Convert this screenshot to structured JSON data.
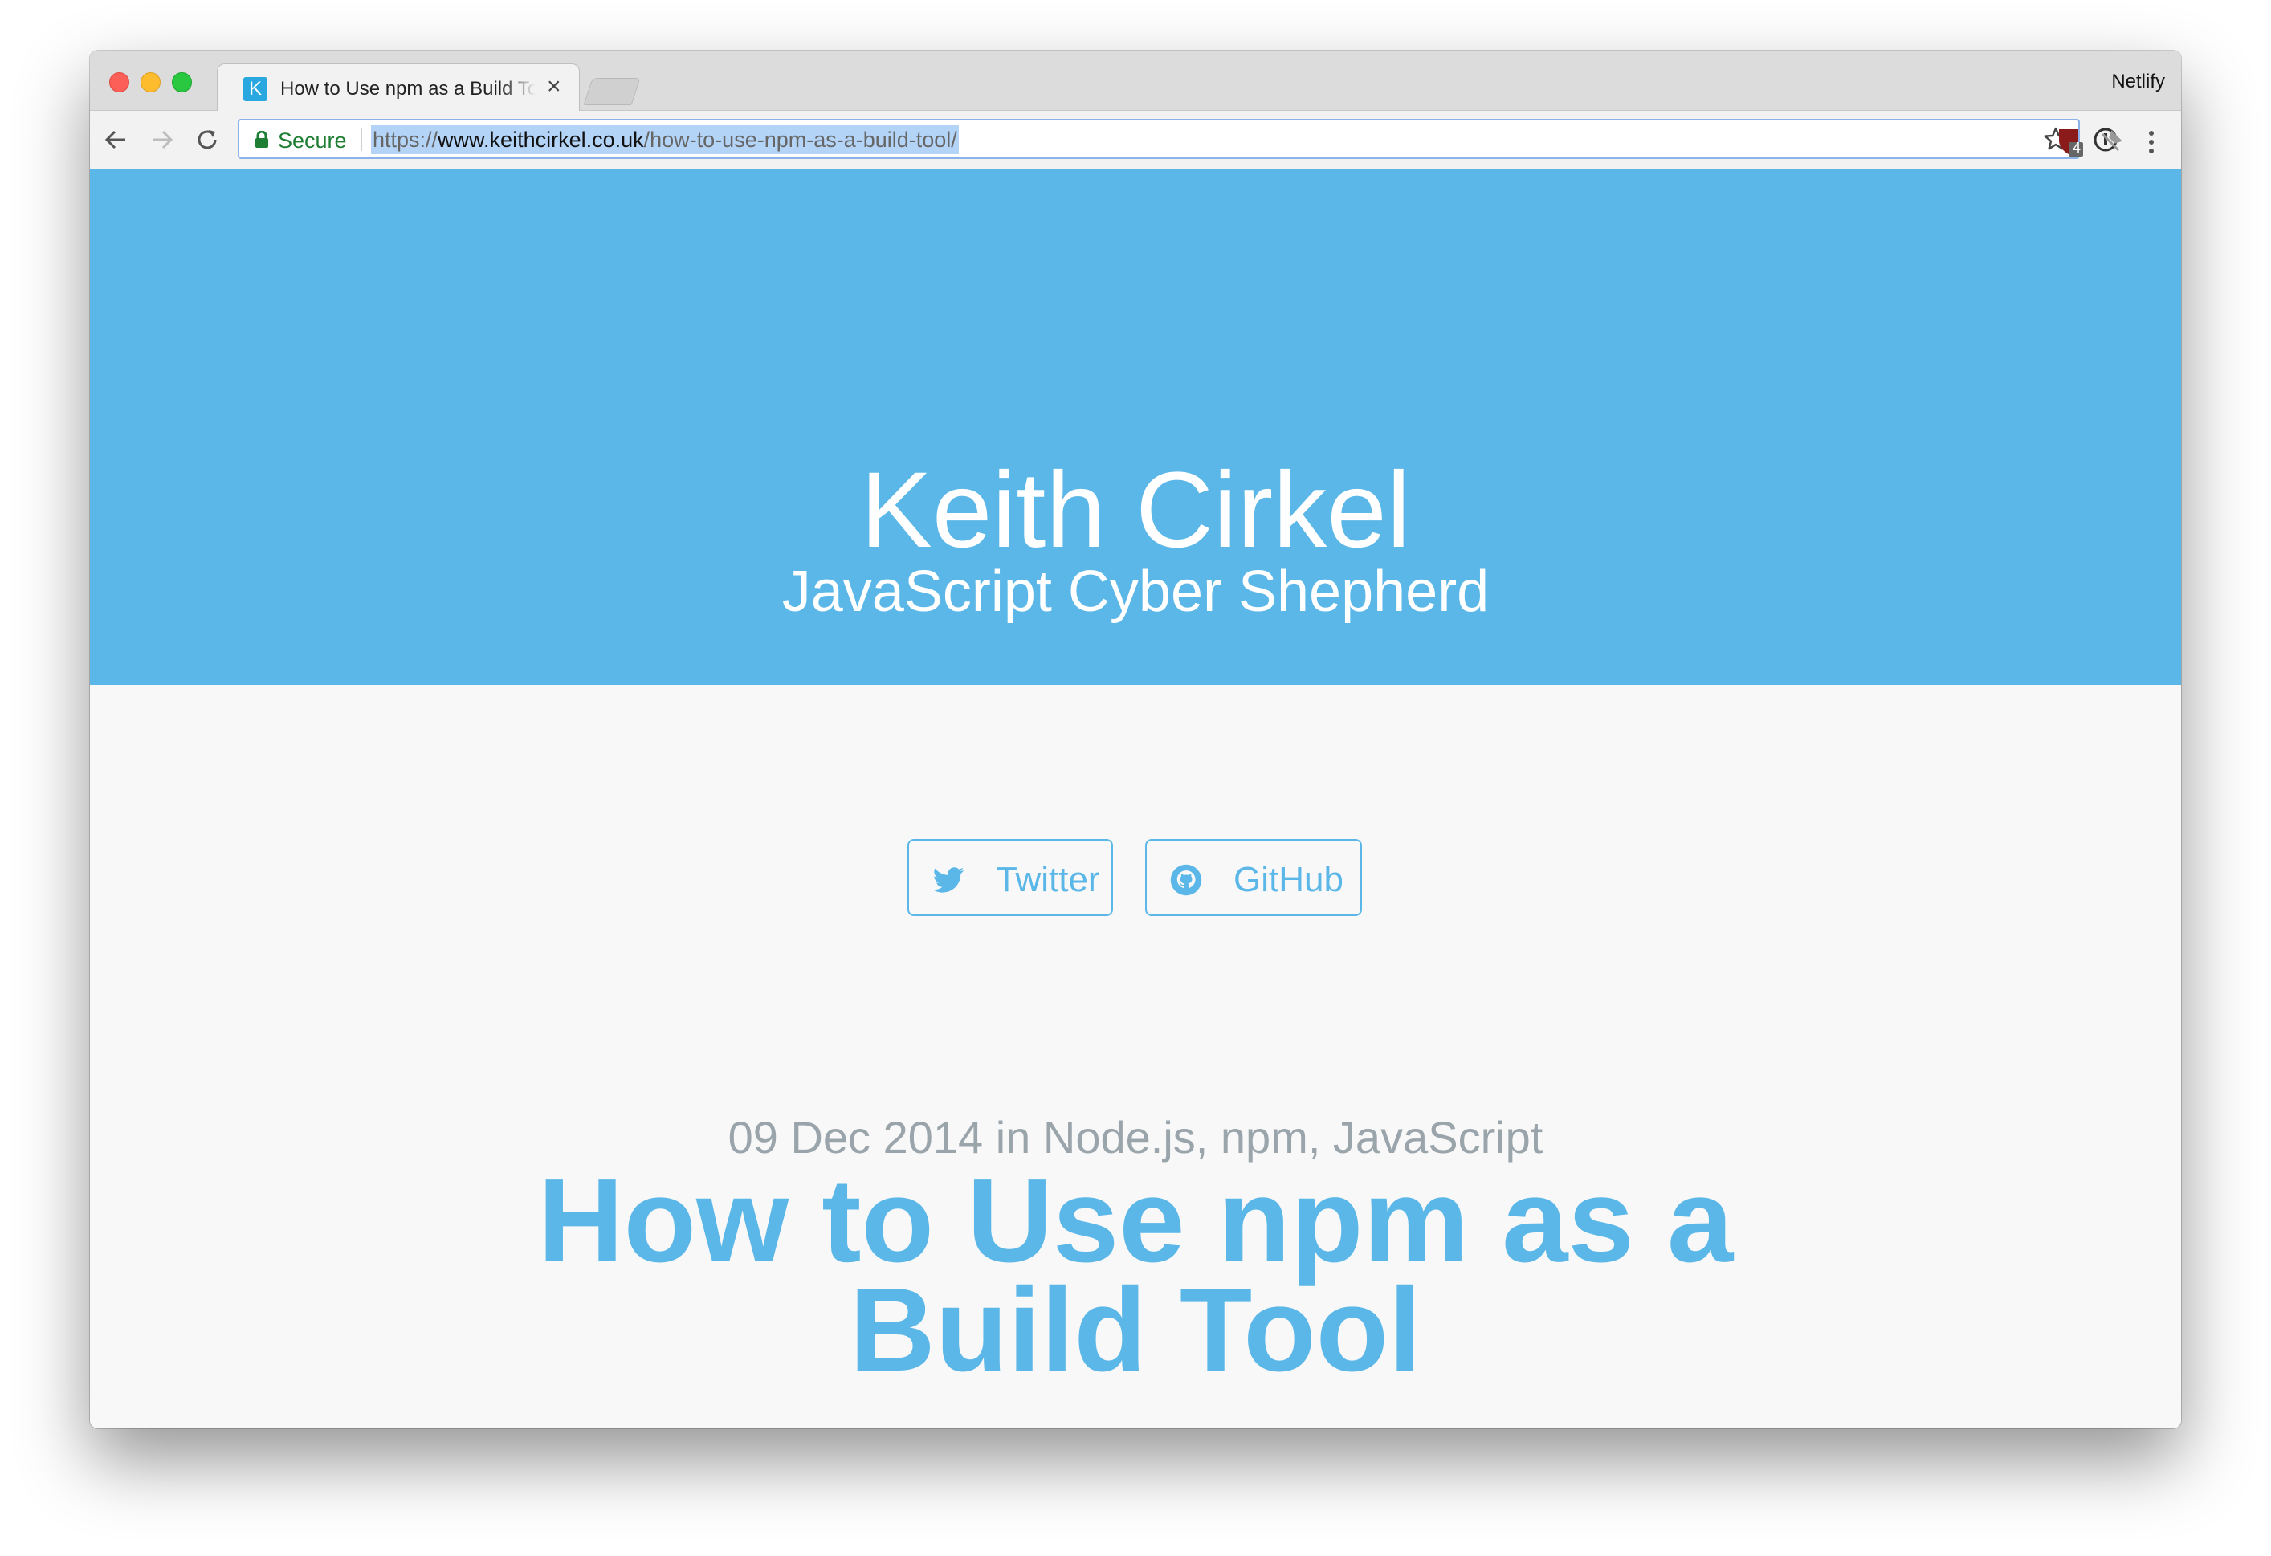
{
  "browser": {
    "tab_title": "How to Use npm as a Build Tool",
    "tab_close": "×",
    "favicon_letter": "K",
    "profile_name": "Netlify",
    "secure_label": "Secure",
    "url_scheme": "https://",
    "url_host": "www.keithcirkel.co.uk",
    "url_path": "/how-to-use-npm-as-a-build-tool/",
    "extension_badge": "4",
    "icons": [
      "back-arrow-icon",
      "forward-arrow-icon",
      "reload-icon",
      "lock-icon",
      "star-icon",
      "password-manager-icon",
      "ublock-icon",
      "pin-icon",
      "menu-dots-icon"
    ]
  },
  "hero": {
    "name": "Keith Cirkel",
    "tagline": "JavaScript Cyber Shepherd",
    "background_color": "#5bb7e8"
  },
  "social": {
    "twitter_label": "Twitter",
    "github_label": "GitHub",
    "accent_color": "#5bb7e8"
  },
  "post": {
    "meta": "09 Dec 2014 in Node.js, npm, JavaScript",
    "title": "How to Use npm as a Build Tool"
  }
}
